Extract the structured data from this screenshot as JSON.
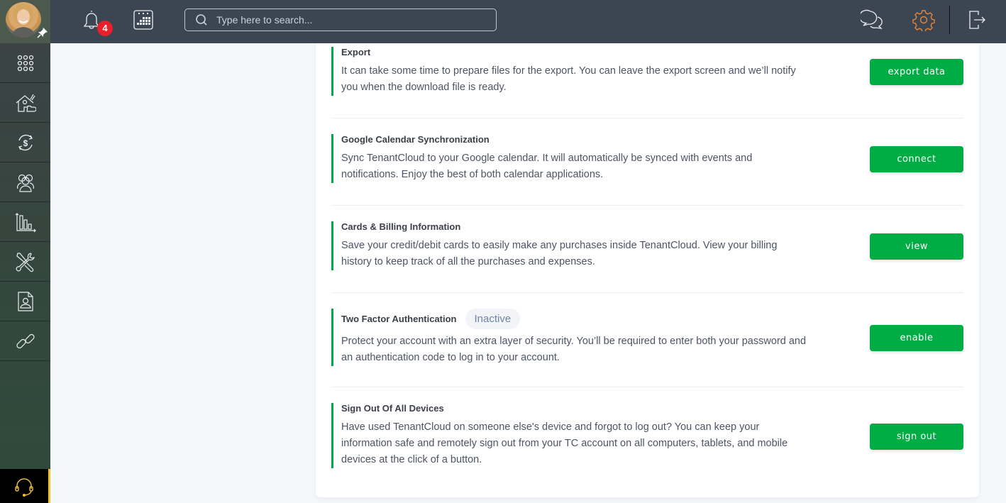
{
  "topbar": {
    "notification_count": "4",
    "search_placeholder": "Type here to search..."
  },
  "sidebar": {
    "items": [
      {
        "icon": "apps-grid-icon"
      },
      {
        "icon": "properties-icon"
      },
      {
        "icon": "accounting-icon"
      },
      {
        "icon": "contacts-icon"
      },
      {
        "icon": "reports-icon"
      },
      {
        "icon": "maintenance-icon"
      },
      {
        "icon": "applications-icon"
      },
      {
        "icon": "link-icon"
      }
    ],
    "support_icon": "headset-icon"
  },
  "colors": {
    "accent_green": "#00ad45",
    "settings_active": "#e8853a",
    "badge_red": "#e8202d",
    "support_yellow": "#f2c12e"
  },
  "sections": [
    {
      "title": "Export",
      "description": "It can take some time to prepare files for the export. You can leave the export screen and we’ll notify you when the download file is ready.",
      "button": "export data"
    },
    {
      "title": "Google Calendar Synchronization",
      "description": "Sync TenantCloud to your Google calendar. It will automatically be synced with events and notifications. Enjoy the best of both calendar applications.",
      "button": "connect"
    },
    {
      "title": "Cards & Billing Information",
      "description": "Save your credit/debit cards to easily make any purchases inside TenantCloud. View your billing history to keep track of all the purchases and expenses.",
      "button": "view"
    },
    {
      "title": "Two Factor Authentication",
      "status": "Inactive",
      "description": "Protect your account with an extra layer of security. You’ll be required to enter both your password and an authentication code to log in to your account.",
      "button": "enable"
    },
    {
      "title": "Sign Out Of All Devices",
      "description": "Have used TenantCloud on someone else's device and forgot to log out? You can keep your information safe and remotely sign out from your TC account on all computers, tablets, and mobile devices at the click of a button.",
      "button": "sign out"
    }
  ]
}
